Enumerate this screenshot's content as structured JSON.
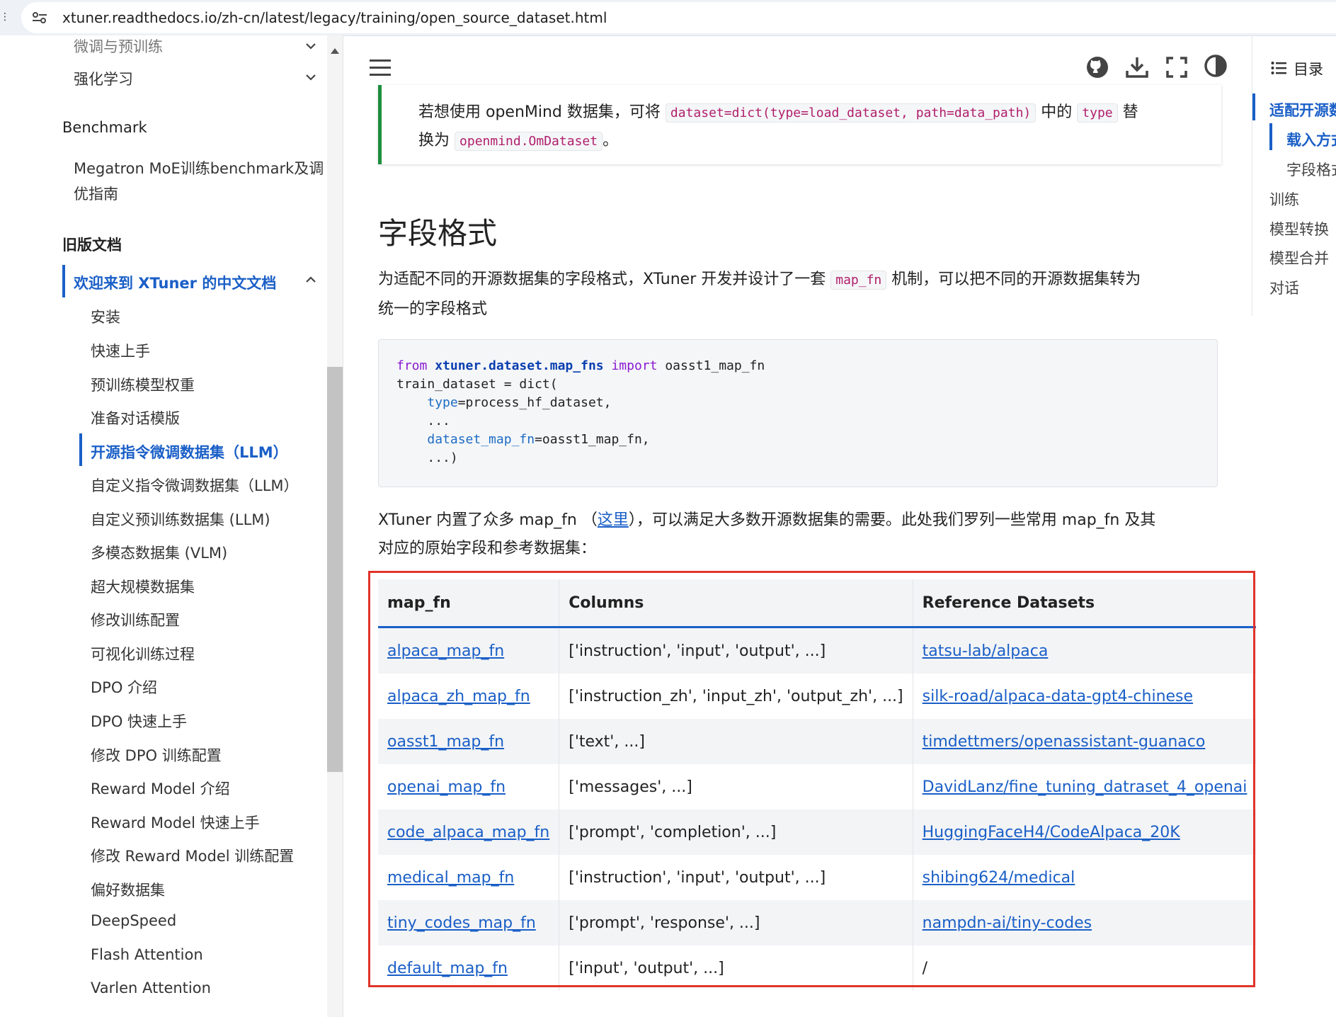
{
  "browser": {
    "url": "xtuner.readthedocs.io/zh-cn/latest/legacy/training/open_source_dataset.html",
    "edge_mark": "⋮"
  },
  "sidebar": {
    "partial_top": "微调与预训练",
    "rl": "强化学习",
    "benchmark_head": "Benchmark",
    "megatron_l1": "Megatron MoE训练benchmark及调",
    "megatron_l2": "优指南",
    "legacy_head": "旧版文档",
    "welcome": "欢迎来到 XTuner 的中文文档",
    "items": [
      "安装",
      "快速上手",
      "预训练模型权重",
      "准备对话模版",
      "开源指令微调数据集（LLM）",
      "自定义指令微调数据集（LLM）",
      "自定义预训练数据集 (LLM)",
      "多模态数据集 (VLM)",
      "超大规模数据集",
      "修改训练配置",
      "可视化训练过程",
      "DPO 介绍",
      "DPO 快速上手",
      "修改 DPO 训练配置",
      "Reward Model 介绍",
      "Reward Model 快速上手",
      "修改 Reward Model 训练配置",
      "偏好数据集",
      "DeepSpeed",
      "Flash Attention",
      "Varlen Attention"
    ]
  },
  "toc": {
    "title": "目录",
    "items": [
      "适配开源数",
      "载入方式",
      "字段格式",
      "训练",
      "模型转换",
      "模型合并",
      "对话"
    ]
  },
  "note": {
    "l1_a": "若想使用 openMind 数据集，可将",
    "l1_code1": "dataset=dict(type=load_dataset, path=data_path)",
    "l1_b": "中的",
    "l1_code2": "type",
    "l1_c": "替",
    "l2_a": "换为",
    "l2_code": "openmind.OmDataset",
    "l2_b": "。"
  },
  "section": {
    "title": "字段格式",
    "p1_l1_a": "为适配不同的开源数据集的字段格式，XTuner 开发并设计了一套",
    "p1_code": "map_fn",
    "p1_l1_b": "机制，可以把不同的开源数据集转为",
    "p1_l2": "统一的字段格式",
    "p2_l1_a": "XTuner 内置了众多 map_fn （",
    "p2_link": "这里",
    "p2_l1_b": "），可以满足大多数开源数据集的需要。此处我们罗列一些常用 map_fn 及其",
    "p2_l2": "对应的原始字段和参考数据集："
  },
  "code": {
    "l1_from": "from",
    "l1_mod": "xtuner.dataset.map_fns",
    "l1_import": "import",
    "l1_name": "oasst1_map_fn",
    "l2": "train_dataset = dict(",
    "l3_key": "type",
    "l3_val": "=process_hf_dataset,",
    "l4": "...",
    "l5_key": "dataset_map_fn",
    "l5_val": "=oasst1_map_fn,",
    "l6": "...)"
  },
  "table": {
    "headers": [
      "map_fn",
      "Columns",
      "Reference Datasets"
    ],
    "rows": [
      [
        "alpaca_map_fn",
        "['instruction', 'input', 'output', ...]",
        "tatsu-lab/alpaca"
      ],
      [
        "alpaca_zh_map_fn",
        "['instruction_zh', 'input_zh', 'output_zh', ...]",
        "silk-road/alpaca-data-gpt4-chinese"
      ],
      [
        "oasst1_map_fn",
        "['text', ...]",
        "timdettmers/openassistant-guanaco"
      ],
      [
        "openai_map_fn",
        "['messages', ...]",
        "DavidLanz/fine_tuning_datraset_4_openai"
      ],
      [
        "code_alpaca_map_fn",
        "['prompt', 'completion', ...]",
        "HuggingFaceH4/CodeAlpaca_20K"
      ],
      [
        "medical_map_fn",
        "['instruction', 'input', 'output', ...]",
        "shibing624/medical"
      ],
      [
        "tiny_codes_map_fn",
        "['prompt', 'response', ...]",
        "nampdn-ai/tiny-codes"
      ],
      [
        "default_map_fn",
        "['input', 'output', ...]",
        "/"
      ]
    ]
  },
  "colors": {
    "accent": "#1a5fc7",
    "note_border": "#1d8e3e",
    "highlight_box": "#e0342b"
  }
}
